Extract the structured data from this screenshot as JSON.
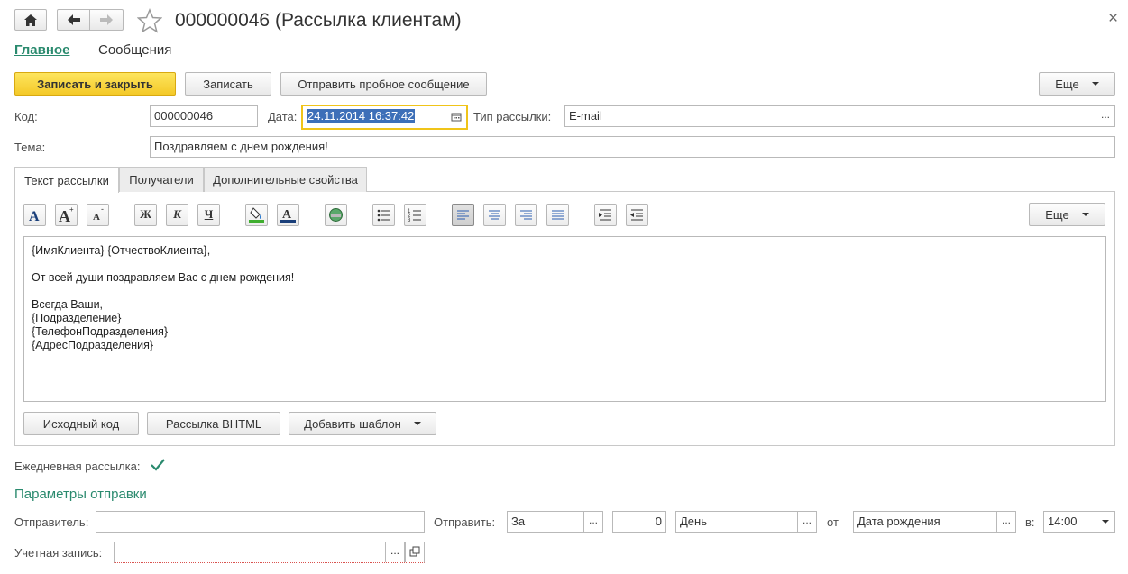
{
  "header": {
    "title": "000000046 (Рассылка клиентам)",
    "close_glyph": "×"
  },
  "subnav": {
    "main": "Главное",
    "messages": "Сообщения"
  },
  "toolbar": {
    "save_close": "Записать и закрыть",
    "save": "Записать",
    "send_test": "Отправить пробное сообщение",
    "more": "Еще"
  },
  "form": {
    "code_label": "Код:",
    "code_value": "000000046",
    "date_label": "Дата:",
    "date_value": "24.11.2014 16:37:42",
    "type_label": "Тип рассылки:",
    "type_value": "E-mail",
    "subject_label": "Тема:",
    "subject_value": "Поздравляем с днем рождения!"
  },
  "tabs": [
    {
      "label": "Текст рассылки"
    },
    {
      "label": "Получатели"
    },
    {
      "label": "Дополнительные свойства"
    }
  ],
  "editor": {
    "more": "Еще",
    "lines": [
      "{ИмяКлиента} {ОтчествоКлиента},",
      "",
      "От всей души поздравляем Вас с днем рождения!",
      "",
      "Всегда Ваши,",
      "{Подразделение}",
      "{ТелефонПодразделения}",
      "{АдресПодразделения}"
    ],
    "btn_source": "Исходный код",
    "btn_html": "Рассылка ВНТML",
    "btn_template": "Добавить шаблон",
    "fmt_bold": "Ж",
    "fmt_italic": "К",
    "fmt_underline": "Ч",
    "icons": [
      "font-icon",
      "increase-font-icon",
      "decrease-font-icon",
      "bold-icon",
      "italic-icon",
      "underline-icon",
      "background-color-icon",
      "text-color-icon",
      "insert-image-icon",
      "bulleted-list-icon",
      "numbered-list-icon",
      "align-left-icon",
      "align-center-icon",
      "align-right-icon",
      "align-justify-icon",
      "increase-indent-icon",
      "decrease-indent-icon"
    ]
  },
  "daily": {
    "label": "Ежедневная рассылка:",
    "checked": true
  },
  "send_params": {
    "title": "Параметры отправки",
    "sender_label": "Отправитель:",
    "sender_value": "",
    "send_label": "Отправить:",
    "send_when": "За",
    "send_count": "0",
    "send_unit": "День",
    "from_label": "от",
    "from_value": "Дата рождения",
    "at_label": "в:",
    "at_value": "14:00",
    "account_label": "Учетная запись:",
    "account_value": ""
  },
  "colors": {
    "accent_green": "#2a8a6e",
    "yellow_button": "#f7d23a",
    "selection": "#3d6fb8"
  }
}
